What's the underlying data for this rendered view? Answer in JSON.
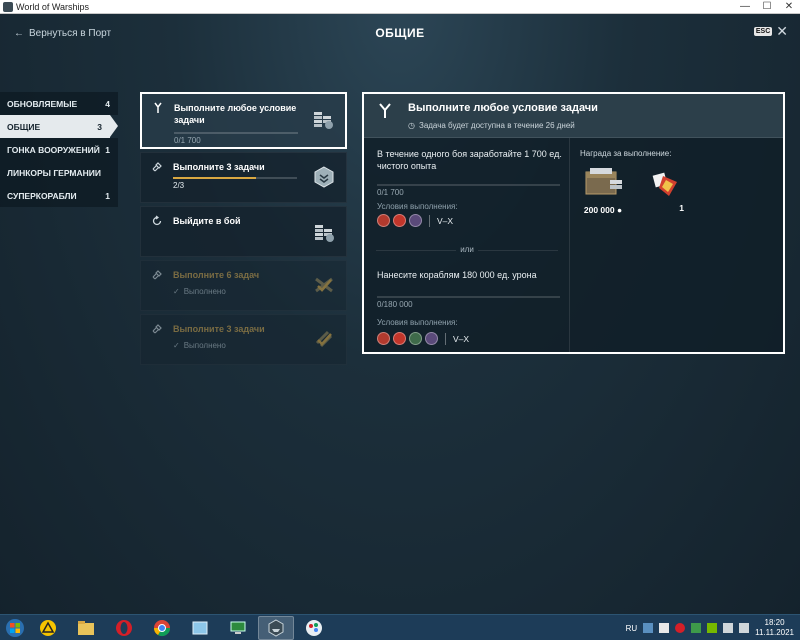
{
  "window": {
    "title": "World of Warships",
    "minimize": "—",
    "maximize": "☐",
    "close": "✕"
  },
  "header": {
    "back_label": "Вернуться в Порт",
    "back_arrow": "←",
    "title": "ОБЩИЕ",
    "esc_label": "ESC",
    "close_glyph": "✕"
  },
  "categories": [
    {
      "label": "ОБНОВЛЯЕМЫЕ",
      "count": "4",
      "active": false
    },
    {
      "label": "ОБЩИЕ",
      "count": "3",
      "active": true
    },
    {
      "label": "ГОНКА ВООРУЖЕНИЙ",
      "count": "1",
      "active": false
    },
    {
      "label": "ЛИНКОРЫ ГЕРМАНИИ",
      "count": "",
      "active": false
    },
    {
      "label": "СУПЕРКОРАБЛИ",
      "count": "1",
      "active": false
    }
  ],
  "tasks": [
    {
      "title": "Выполните любое условие задачи",
      "progress": "0/1 700",
      "fill": 0.0,
      "icon": "branch-icon",
      "reward_icon": "credits-icon"
    },
    {
      "title": "Выполните 3 задачи",
      "progress": "2/3",
      "fill": 0.67,
      "icon": "chain-link-icon",
      "reward_icon": "commander-badge-icon"
    },
    {
      "title": "Выйдите в бой",
      "icon": "refresh-icon",
      "reward_icon": "credits-icon"
    },
    {
      "title": "Выполните 6 задач",
      "done_label": "Выполнено",
      "icon": "chain-link-icon",
      "reward_icon": "checkmark-badge-icon"
    },
    {
      "title": "Выполните 3 задачи",
      "done_label": "Выполнено",
      "icon": "chain-link-icon",
      "reward_icon": "checkmark-badge-icon"
    }
  ],
  "detail": {
    "title": "Выполните любое условие задачи",
    "subtitle": "Задача будет доступна в течение 26 дней",
    "condition1": {
      "text": "В течение одного боя заработайте 1 700 ед. чистого опыта",
      "progress": "0/1 700",
      "fill": 0.0,
      "label": "Условия выполнения:",
      "tiers": "V–X"
    },
    "or_label": "или",
    "condition2": {
      "text": "Нанесите кораблям 180 000 ед. урона",
      "progress": "0/180 000",
      "fill": 0.0,
      "label": "Условия выполнения:",
      "tiers": "V–X"
    },
    "reward_heading": "Награда за выполнение:",
    "rewards": [
      {
        "icon": "credits-crate-icon",
        "amount": "200 000"
      },
      {
        "icon": "signal-flag-icon",
        "amount": "1"
      }
    ]
  },
  "taskbar": {
    "lang": "RU",
    "time": "18:20",
    "date": "11.11.2021"
  },
  "colors": {
    "accent": "#d9a842",
    "done": "#c89f4b",
    "panel_border": "#ffffff"
  }
}
